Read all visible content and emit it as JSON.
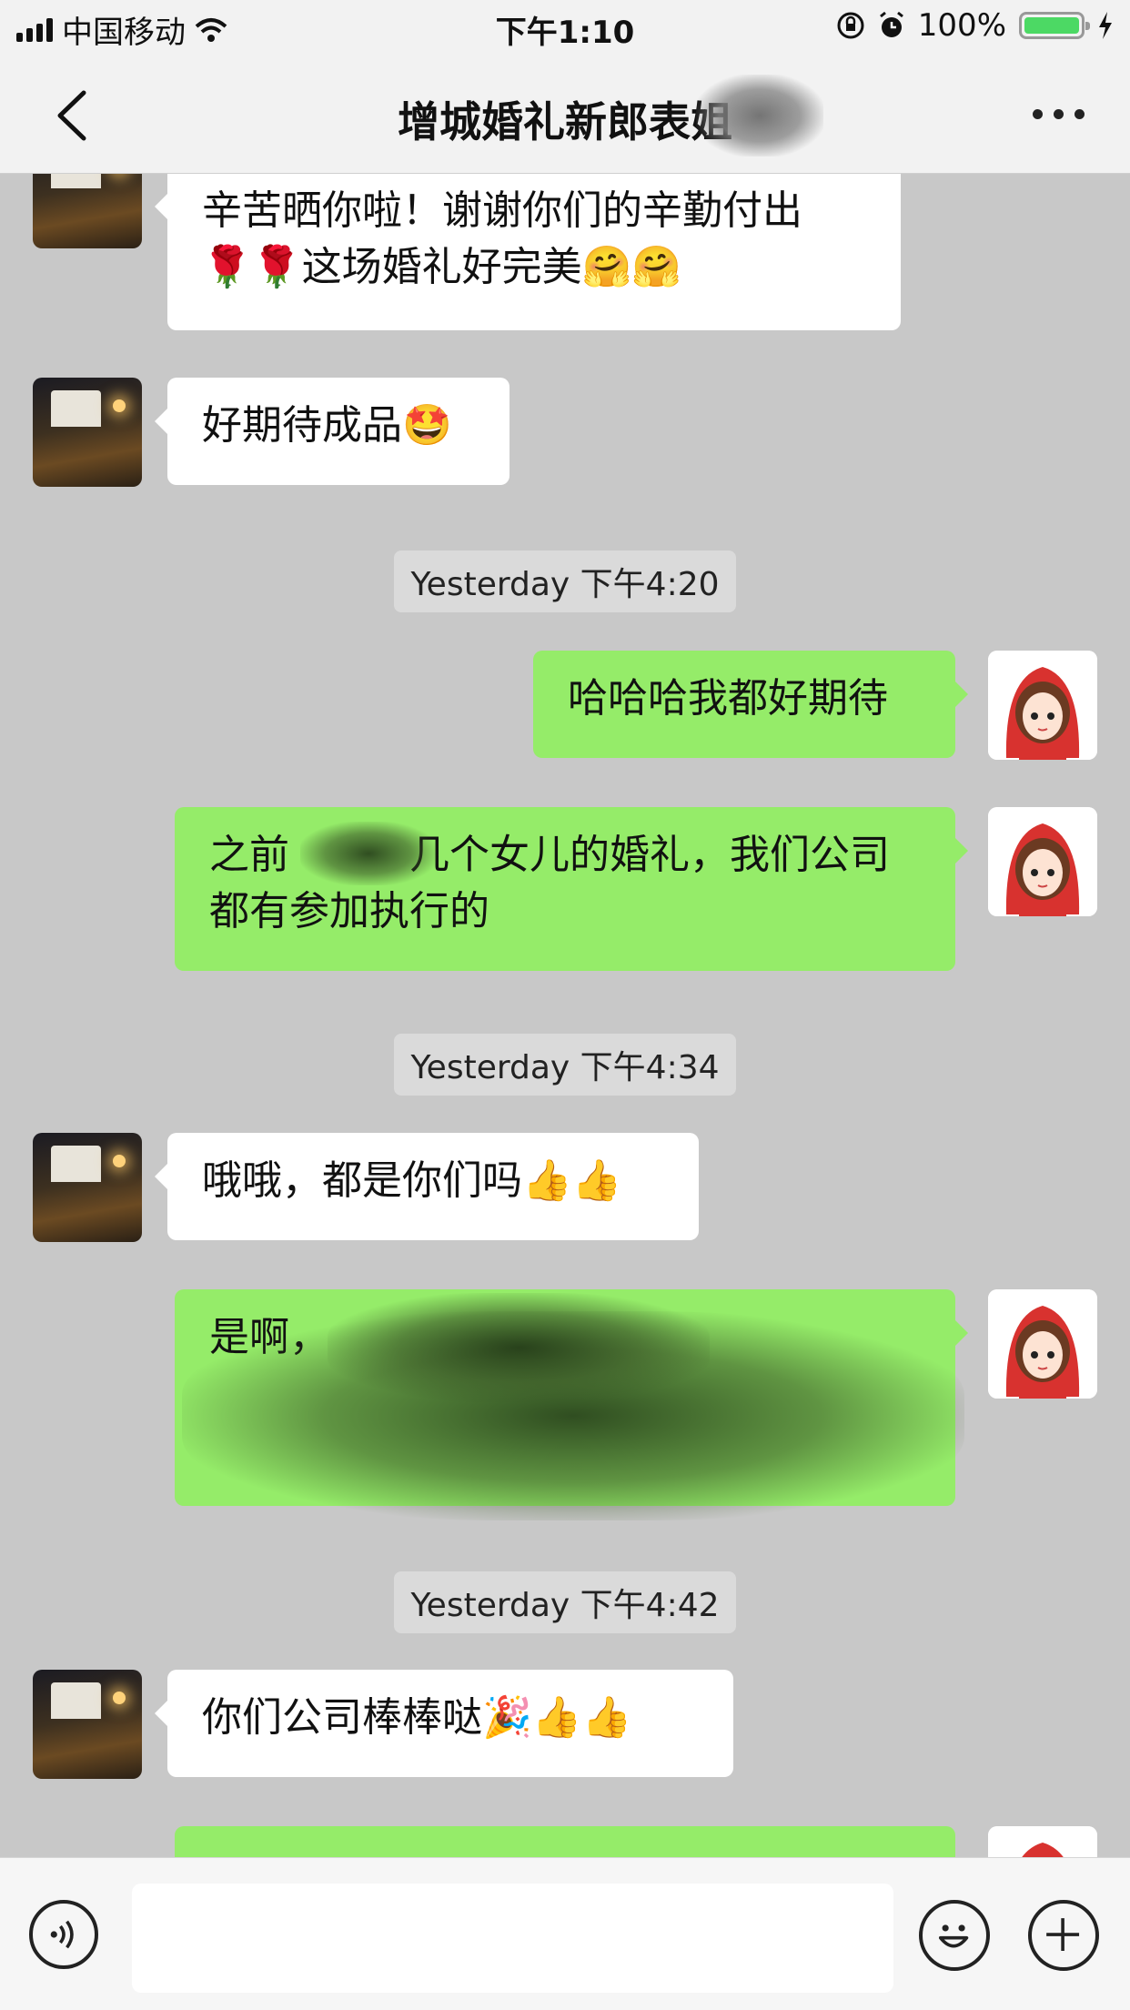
{
  "status_bar": {
    "carrier": "中国移动",
    "time": "下午1:10",
    "battery": "100%"
  },
  "nav": {
    "title": "增城婚礼新郎表姐"
  },
  "chat": {
    "messages": [
      {
        "text": "辛苦晒你啦！谢谢你们的辛勤付出\n🌹🌹这场婚礼好完美🤗🤗"
      },
      {
        "text": "好期待成品🤩"
      },
      {
        "timestamp": "Yesterday 下午4:20"
      },
      {
        "text": "哈哈哈我都好期待"
      },
      {
        "text": "之前　　　几个女儿的婚礼，我们公司\n都有参加执行的"
      },
      {
        "timestamp": "Yesterday 下午4:34"
      },
      {
        "text": "哦哦，都是你们吗👍👍"
      },
      {
        "text": "是啊，"
      },
      {
        "timestamp": "Yesterday 下午4:42"
      },
      {
        "text": "你们公司棒棒哒🎉👍👍"
      }
    ]
  },
  "colors": {
    "chat_bg": "#c8c8c8",
    "bubble_self": "#95ec69",
    "bubble_other": "#ffffff"
  }
}
